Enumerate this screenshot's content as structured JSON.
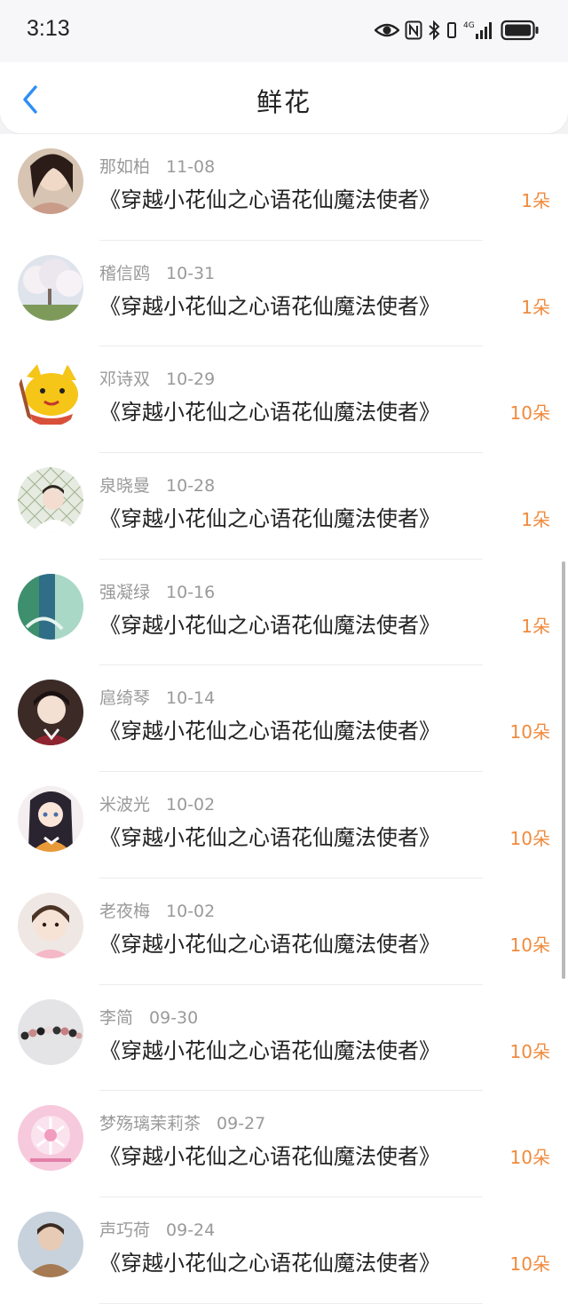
{
  "status": {
    "time": "3:13"
  },
  "header": {
    "title": "鲜花"
  },
  "icons": {
    "back": "chevron-left-icon",
    "eye": "eye-icon",
    "nfc": "nfc-icon",
    "bluetooth": "bluetooth-icon",
    "signal": "signal-icon",
    "battery": "battery-icon"
  },
  "colors": {
    "accent": "#2f8ef5",
    "count": "#f08a3c"
  },
  "items": [
    {
      "name": "那如柏",
      "date": "11-08",
      "book": "《穿越小花仙之心语花仙魔法使者》",
      "count": "1朵"
    },
    {
      "name": "稽信鸥",
      "date": "10-31",
      "book": "《穿越小花仙之心语花仙魔法使者》",
      "count": "1朵"
    },
    {
      "name": "邓诗双",
      "date": "10-29",
      "book": "《穿越小花仙之心语花仙魔法使者》",
      "count": "10朵"
    },
    {
      "name": "泉晓曼",
      "date": "10-28",
      "book": "《穿越小花仙之心语花仙魔法使者》",
      "count": "1朵"
    },
    {
      "name": "强凝绿",
      "date": "10-16",
      "book": "《穿越小花仙之心语花仙魔法使者》",
      "count": "1朵"
    },
    {
      "name": "扈绮琴",
      "date": "10-14",
      "book": "《穿越小花仙之心语花仙魔法使者》",
      "count": "10朵"
    },
    {
      "name": "米波光",
      "date": "10-02",
      "book": "《穿越小花仙之心语花仙魔法使者》",
      "count": "10朵"
    },
    {
      "name": "老夜梅",
      "date": "10-02",
      "book": "《穿越小花仙之心语花仙魔法使者》",
      "count": "10朵"
    },
    {
      "name": "李简",
      "date": "09-30",
      "book": "《穿越小花仙之心语花仙魔法使者》",
      "count": "10朵"
    },
    {
      "name": "梦殇璃茉莉茶",
      "date": "09-27",
      "book": "《穿越小花仙之心语花仙魔法使者》",
      "count": "10朵"
    },
    {
      "name": "声巧荷",
      "date": "09-24",
      "book": "《穿越小花仙之心语花仙魔法使者》",
      "count": "10朵"
    }
  ]
}
